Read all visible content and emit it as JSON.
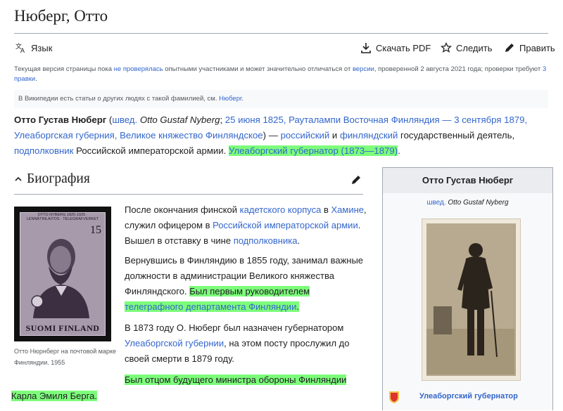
{
  "page": {
    "title": "Нюберг, Отто"
  },
  "toolbar": {
    "language": "Язык",
    "download_pdf": "Скачать PDF",
    "watch": "Следить",
    "edit": "Править"
  },
  "notice": {
    "t1": "Текущая версия страницы пока ",
    "l1": "не проверялась",
    "t2": " опытными участниками и может значительно отличаться от ",
    "l2": "версии",
    "t3": ", проверенной 2 августа 2021 года; проверки требуют ",
    "l3": "3 правки",
    "t4": "."
  },
  "hatnote": {
    "text": "В Википедии есть статьи о других людях с такой фамилией, см. ",
    "link": "Нюберг",
    "end": "."
  },
  "lead": {
    "name": "Отто Густав Нюберг",
    "p_open": " (",
    "shved": "швед.",
    "orig": " Otto Gustaf Nyberg",
    "semi": "; ",
    "birth": "25 июня 1825, Рауталампи Восточная Финляндия — 3 сентября 1879, Улеаборгская губерния, Великое княжество Финляндское",
    "p_close": ") — ",
    "russian": "российский",
    "and": " и ",
    "finnish": "финляндский",
    "statesman": " государственный деятель, ",
    "lt_col": "подполковник",
    "army": " Российской императорской армии. ",
    "governor": "Улеаборгский губернатор (1873—1879)",
    "end": "."
  },
  "section": {
    "title": "Биография"
  },
  "stamp": {
    "top_text": "OTTO NYBERG 1825·1925 · LENNÄTINLAITOS · TELEGRAFVERKET",
    "value": "15",
    "country": "SUOMI FINLAND",
    "caption": "Отто Нюрнберг на почтовой марке Финляндии. 1955"
  },
  "bio": {
    "p1": {
      "t1": "После окончания финской ",
      "l1": "кадетского корпуса",
      "t2": " в ",
      "l2": "Хамине",
      "t3": ", служил офицером в ",
      "l3": "Российской императорской армии",
      "t4": ". Вышел в отставку в чине ",
      "l4": "подполковника",
      "t5": "."
    },
    "p2": {
      "t1": "Вернувшись в Финляндию в 1855 году, занимал важные должности в администрации Великого княжества Финляндского. ",
      "h1": "Был первым руководителем ",
      "hl1": "телеграфного департамента Финляндии",
      "h2": "."
    },
    "p3": {
      "t1": "В 1873 году О. Нюберг был назначен губернатором ",
      "l1": "Улеаборгской губернии",
      "t2": ", на этом посту прослужил до своей смерти в 1879 году."
    },
    "p4": "Был отцом будущего министра обороны Финляндии",
    "p5": "Карла Эмиля Берга."
  },
  "infobox": {
    "title": "Отто Густав Нюберг",
    "sub_link": "швед.",
    "sub_text": " Otto Gustaf Nyberg",
    "footer": "Улеаборгский губернатор"
  },
  "colors": {
    "link": "#3366cc",
    "highlight": "#7dfc7b",
    "border": "#a2a9b1"
  },
  "icons": [
    "translate-icon",
    "download-icon",
    "star-icon",
    "pencil-icon",
    "chevron-up-icon",
    "coat-of-arms-icon"
  ]
}
